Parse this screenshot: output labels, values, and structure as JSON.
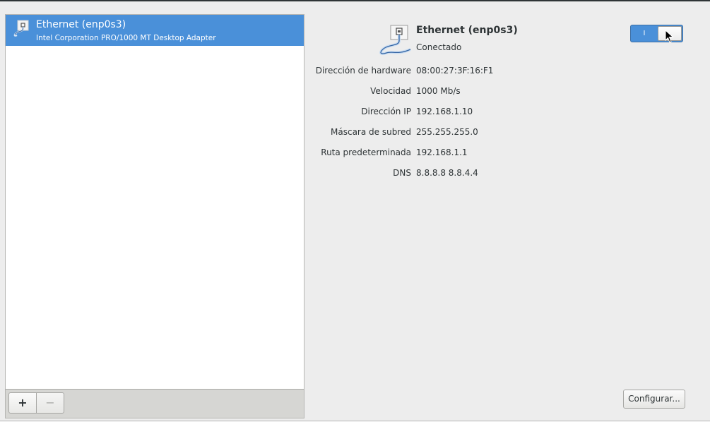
{
  "device_list": {
    "items": [
      {
        "name": "Ethernet (enp0s3)",
        "description": "Intel Corporation PRO/1000 MT Desktop Adapter",
        "selected": true,
        "icon": "wired-network-icon"
      }
    ]
  },
  "toolbar": {
    "add_label": "+",
    "remove_label": "−"
  },
  "detail": {
    "title": "Ethernet (enp0s3)",
    "status": "Conectado",
    "switch": {
      "state_label": "I",
      "on": true
    },
    "rows": [
      {
        "label": "Dirección de hardware",
        "value": "08:00:27:3F:16:F1"
      },
      {
        "label": "Velocidad",
        "value": "1000 Mb/s"
      },
      {
        "label": "Dirección IP",
        "value": "192.168.1.10"
      },
      {
        "label": "Máscara de subred",
        "value": "255.255.255.0"
      },
      {
        "label": "Ruta predeterminada",
        "value": "192.168.1.1"
      },
      {
        "label": "DNS",
        "value": "8.8.8.8 8.8.4.4"
      }
    ],
    "configure_label": "Configurar..."
  },
  "colors": {
    "selection": "#4a90d9",
    "background": "#ededed"
  }
}
